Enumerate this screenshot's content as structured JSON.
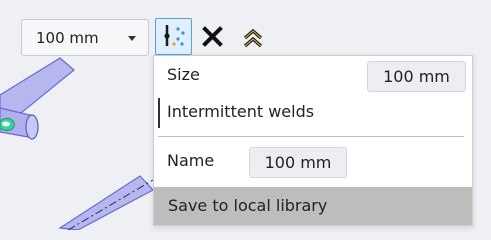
{
  "toolbar": {
    "size_value": "100 mm",
    "weld_settings_icon": "weld-settings-icon",
    "close_icon": "close-icon",
    "collapse_icon": "double-chevron-up-icon"
  },
  "popup": {
    "size_label": "Size",
    "size_value": "100 mm",
    "intermittent_label": "Intermittent welds",
    "name_label": "Name",
    "name_value": "100 mm",
    "save_label": "Save to local library"
  },
  "colors": {
    "accent_blue": "#4a90d9",
    "close_x": "#111111",
    "collapse_gold": "#b58a2a",
    "beam_fill": "#b4b6f0",
    "save_row_bg": "#bdbdbd"
  }
}
